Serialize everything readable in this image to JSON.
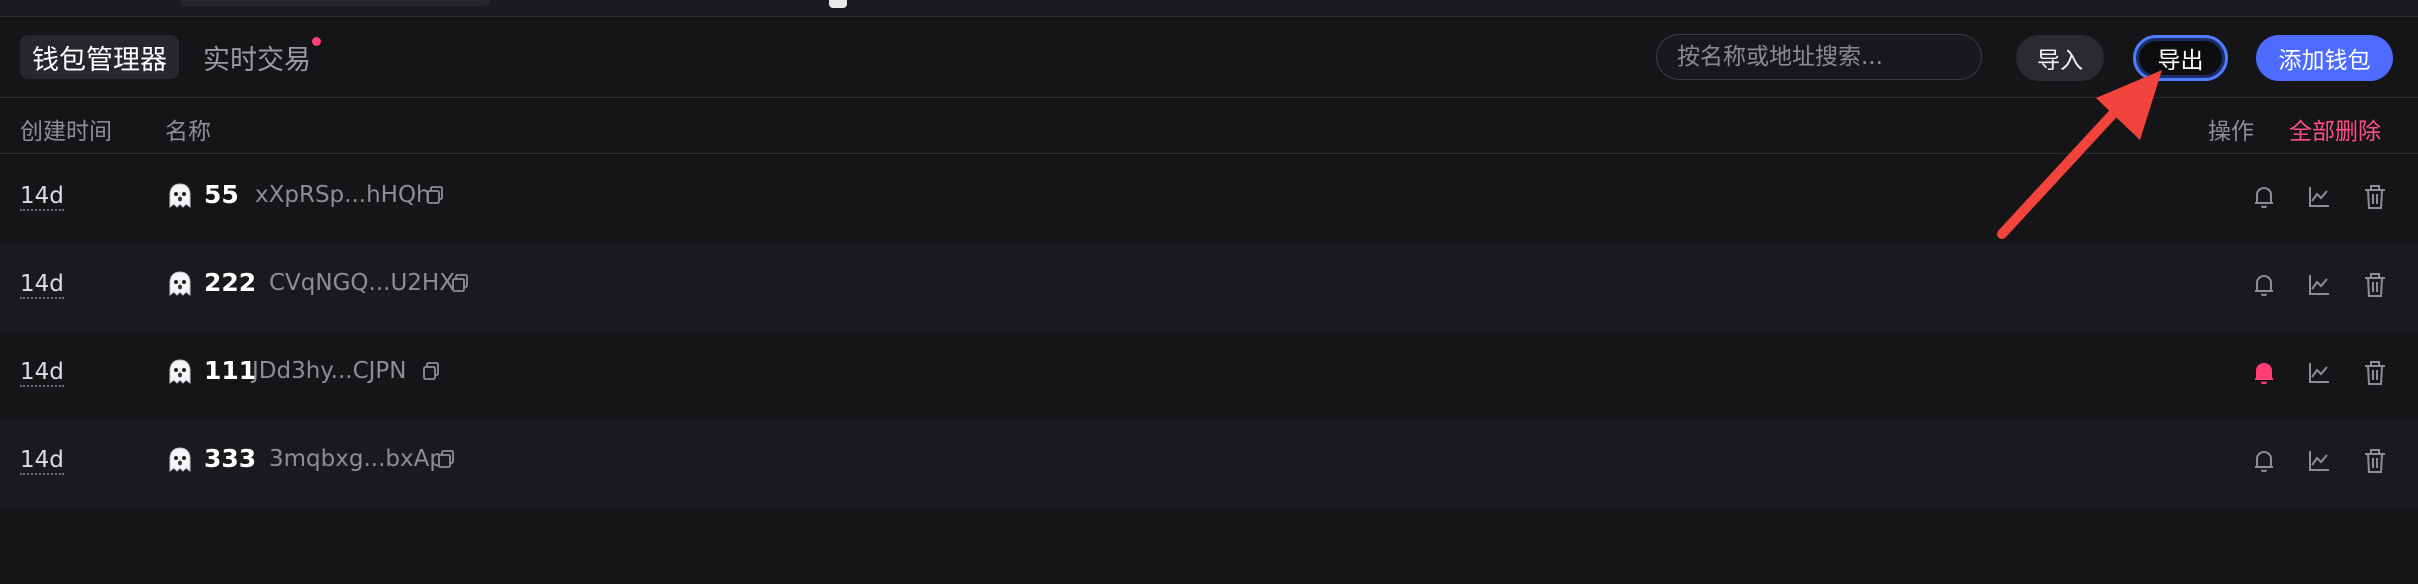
{
  "tabs": {
    "wallet_manager": "钱包管理器",
    "realtime_trading": "实时交易"
  },
  "search": {
    "placeholder": "按名称或地址搜索..."
  },
  "buttons": {
    "import": "导入",
    "export": "导出",
    "add_wallet": "添加钱包"
  },
  "table": {
    "headers": {
      "created_time": "创建时间",
      "name": "名称",
      "actions": "操作",
      "delete_all": "全部删除"
    },
    "rows": [
      {
        "time": "14d",
        "name": "55",
        "address": "xXpRSp...hHQh",
        "bell_active": false
      },
      {
        "time": "14d",
        "name": "222",
        "address": "CVqNGQ...U2HX",
        "bell_active": false
      },
      {
        "time": "14d",
        "name": "111",
        "address": "JDd3hy...CJPN",
        "bell_active": true
      },
      {
        "time": "14d",
        "name": "333",
        "address": "3mqbxg...bxAp",
        "bell_active": false
      }
    ]
  },
  "colors": {
    "accent_blue": "#4d6cff",
    "danger_pink": "#ff4d86",
    "annotation_arrow": "#f2433c"
  },
  "icons": [
    "ghost-icon",
    "copy-icon",
    "bell-icon",
    "chart-icon",
    "trash-icon",
    "arrow-annotation"
  ]
}
